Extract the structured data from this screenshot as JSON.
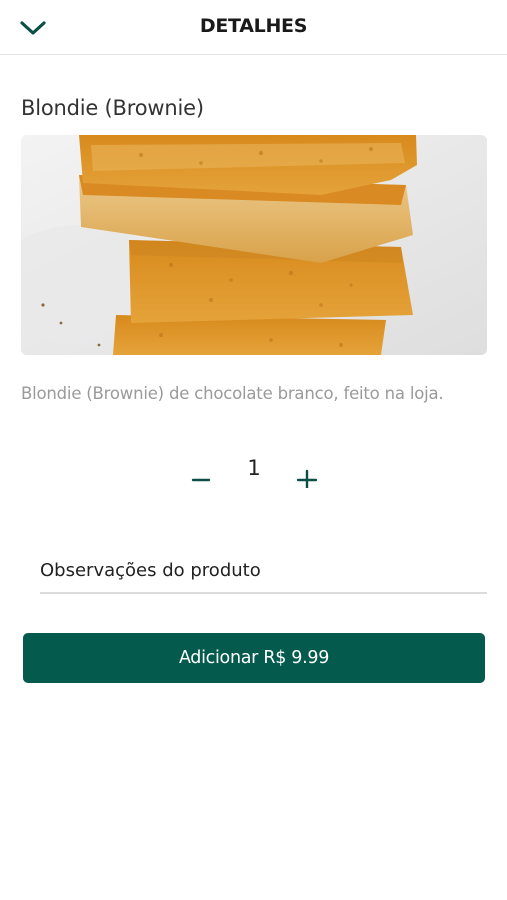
{
  "header": {
    "title": "DETALHES",
    "back_icon": "chevron-down-icon"
  },
  "product": {
    "name": "Blondie (Brownie)",
    "description": "Blondie (Brownie) de chocolate branco, feito na loja.",
    "image_icon": "product-photo"
  },
  "quantity": {
    "value": "1",
    "minus_icon": "minus-icon",
    "plus_icon": "plus-icon"
  },
  "notes": {
    "placeholder": "Observações do produto",
    "value": ""
  },
  "add_button": {
    "label": "Adicionar R$ 9.99"
  },
  "colors": {
    "accent": "#045a4c",
    "header_border": "#e3e3e3",
    "description_text": "#9a9a9a"
  }
}
